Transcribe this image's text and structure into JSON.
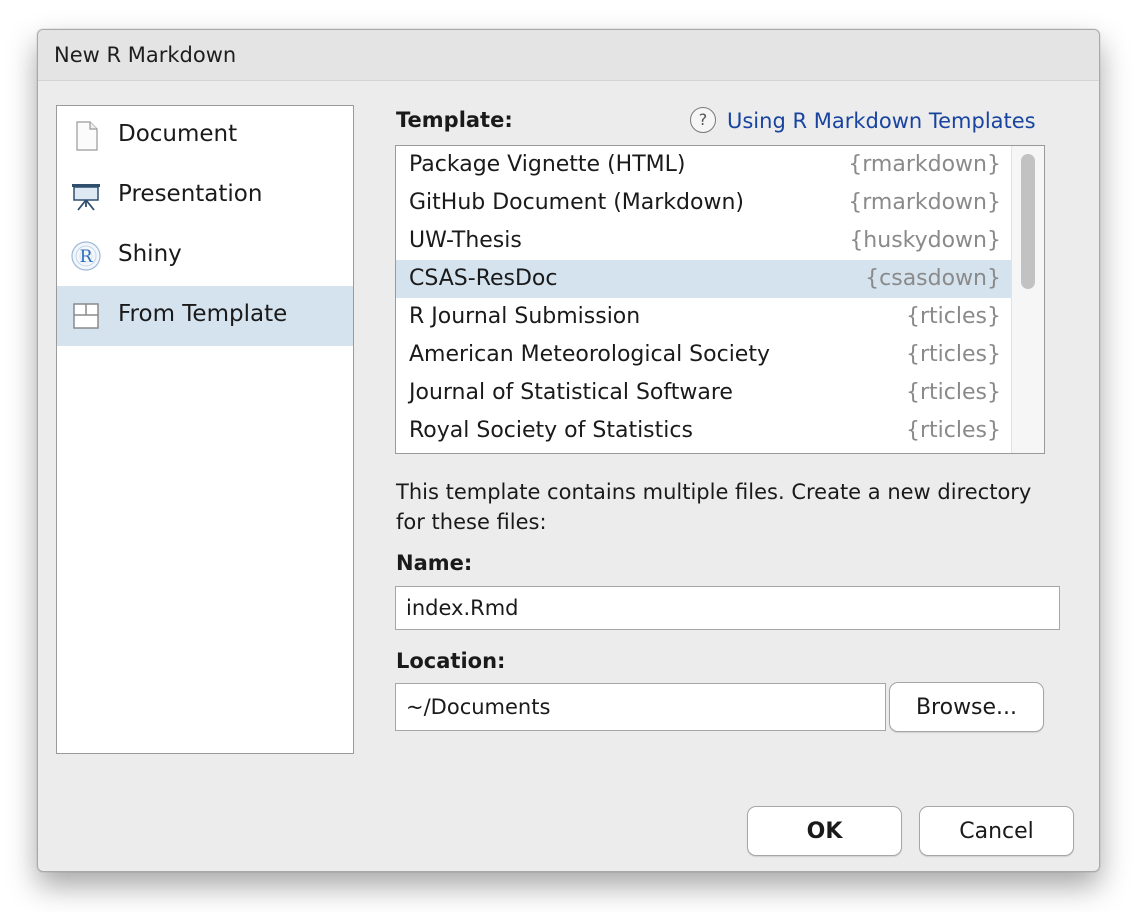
{
  "window": {
    "title": "New R Markdown"
  },
  "sidebar": {
    "items": [
      {
        "label": "Document",
        "icon": "document-icon",
        "selected": false
      },
      {
        "label": "Presentation",
        "icon": "presentation-icon",
        "selected": false
      },
      {
        "label": "Shiny",
        "icon": "shiny-r-icon",
        "selected": false
      },
      {
        "label": "From Template",
        "icon": "template-icon",
        "selected": true
      }
    ]
  },
  "template_section": {
    "label": "Template:",
    "help_icon": "help-icon",
    "help_link": "Using R Markdown Templates",
    "selected_index": 3,
    "templates": [
      {
        "name": "Package Vignette (HTML)",
        "package": "{rmarkdown}"
      },
      {
        "name": "GitHub Document (Markdown)",
        "package": "{rmarkdown}"
      },
      {
        "name": "UW-Thesis",
        "package": "{huskydown}"
      },
      {
        "name": "CSAS-ResDoc",
        "package": "{csasdown}"
      },
      {
        "name": "R Journal Submission",
        "package": "{rticles}"
      },
      {
        "name": "American Meteorological Society",
        "package": "{rticles}"
      },
      {
        "name": "Journal of Statistical Software",
        "package": "{rticles}"
      },
      {
        "name": "Royal Society of Statistics",
        "package": "{rticles}"
      }
    ]
  },
  "description": "This template contains multiple files. Create a new directory for these files:",
  "name_field": {
    "label": "Name:",
    "value": "index.Rmd"
  },
  "location_field": {
    "label": "Location:",
    "value": "~/Documents",
    "browse_label": "Browse..."
  },
  "buttons": {
    "ok": "OK",
    "cancel": "Cancel"
  },
  "colors": {
    "selection": "#d5e3ef",
    "link": "#1844a0",
    "dialog_bg": "#ececec"
  }
}
